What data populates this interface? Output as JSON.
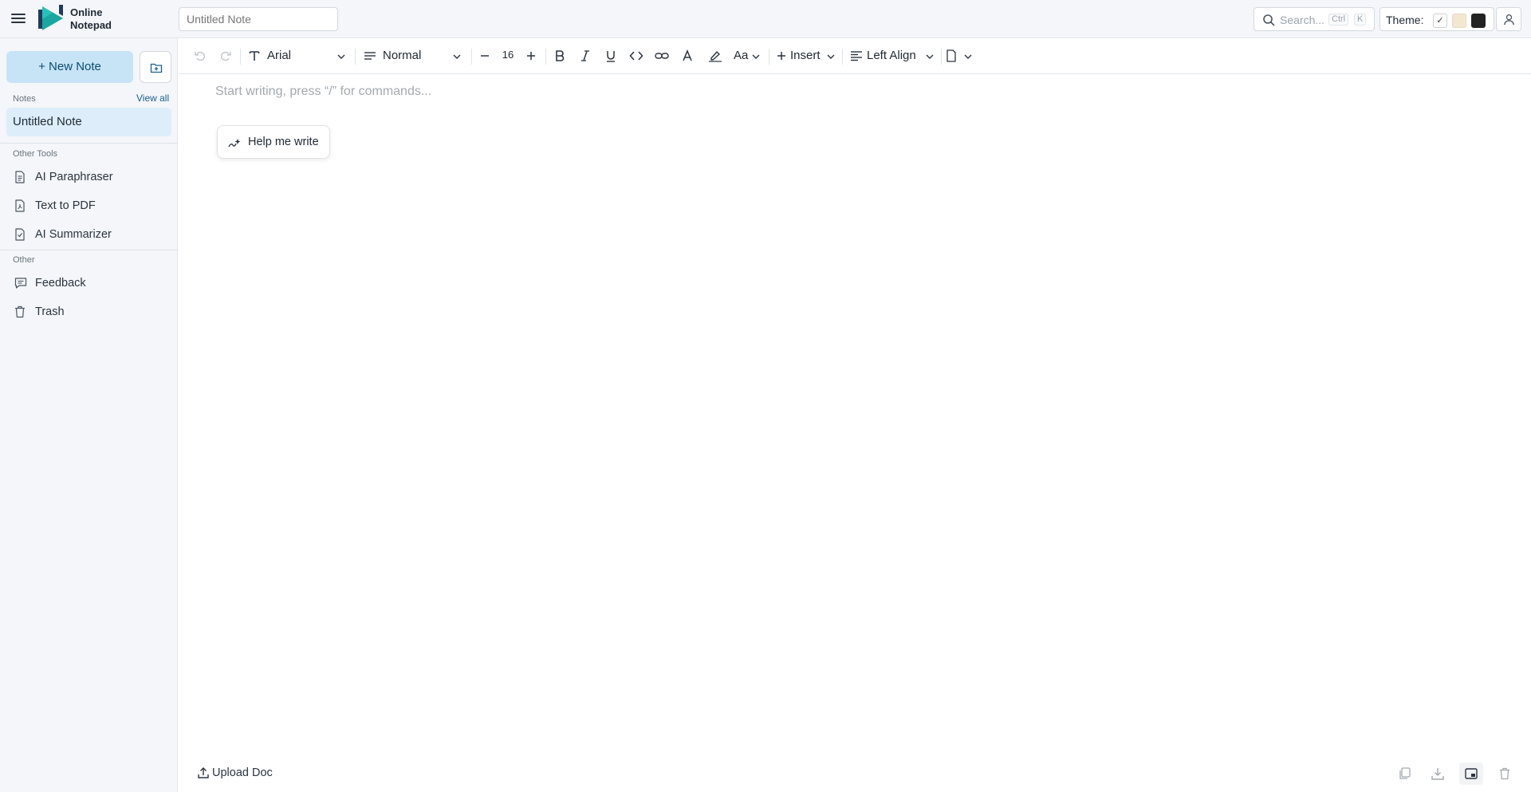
{
  "app": {
    "brand_line1": "Online",
    "brand_line2": "Notepad"
  },
  "header": {
    "note_title_placeholder": "Untitled Note",
    "search_placeholder": "Search...",
    "search_shortcut_mod": "Ctrl",
    "search_shortcut_key": "K",
    "theme_label": "Theme:",
    "theme_selected_mark": "✓"
  },
  "sidebar": {
    "new_note_label": "+ New Note",
    "notes_section": "Notes",
    "view_all": "View all",
    "notes": [
      {
        "title": "Untitled Note"
      }
    ],
    "other_tools_section": "Other Tools",
    "tools": [
      {
        "label": "AI Paraphraser",
        "icon": "document-icon"
      },
      {
        "label": "Text to PDF",
        "icon": "pdf-icon"
      },
      {
        "label": "AI Summarizer",
        "icon": "summary-icon"
      }
    ],
    "other_section": "Other",
    "other": [
      {
        "label": "Feedback",
        "icon": "chat-icon"
      },
      {
        "label": "Trash",
        "icon": "trash-icon"
      }
    ]
  },
  "toolbar": {
    "font_family": "Arial",
    "block_style": "Normal",
    "font_size": "16",
    "case_label": "Aa",
    "insert_label": "Insert",
    "align_label": "Left Align"
  },
  "editor": {
    "placeholder": "Start writing, press “/” for commands...",
    "help_label": "Help me write"
  },
  "footer": {
    "upload_label": "Upload Doc"
  },
  "colors": {
    "accent": "#c7e4f7",
    "accent_text": "#0c4a72",
    "selected_note_bg": "#ddeefa",
    "theme_sepia": "#f3e7d1",
    "theme_dark": "#222222",
    "logo_teal": "#19a7a0",
    "logo_navy": "#1e3a5f"
  }
}
